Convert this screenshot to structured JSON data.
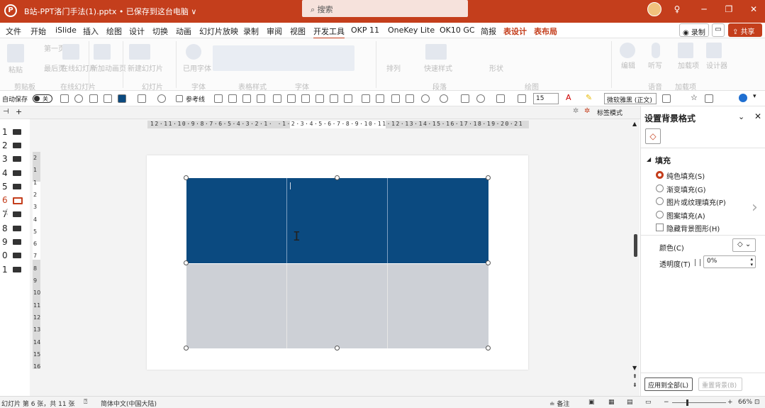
{
  "titlebar": {
    "title": "B站-PPT洛门手法(1).pptx • 已保存到这台电脑 ∨",
    "search_placeholder": "搜索",
    "accent": "#c43e1c"
  },
  "menu": {
    "tabs": [
      "文件",
      "开始",
      "iSlide",
      "插入",
      "绘图",
      "设计",
      "切换",
      "动画",
      "幻灯片放映",
      "录制",
      "审阅",
      "视图",
      "开发工具",
      "OKP 11",
      "OneKey Lite",
      "OK10 GC",
      "简报",
      "表设计",
      "表布局"
    ],
    "record_label": "录制",
    "share_label": "共享"
  },
  "ribbon": {
    "labels": [
      "粘贴",
      "剪贴板",
      "第一页",
      "最后页",
      "在线幻灯片",
      "在线幻灯片",
      "新加动画页",
      "新建幻灯片",
      "幻灯片",
      "已用字体",
      "字体",
      "表格样式",
      "字体",
      "排列",
      "快速样式",
      "形状",
      "段落",
      "绘图",
      "编辑",
      "听写",
      "语音",
      "加载项",
      "设计器",
      "加载项"
    ]
  },
  "qat": {
    "autosave_label": "自动保存",
    "autosave_state": "关",
    "ref_line_label": "参考线",
    "font_size": "15",
    "font_name": "微软雅黑 (正文)"
  },
  "thumbs": {
    "numbers": [
      "1",
      "2",
      "3",
      "4",
      "5",
      "6",
      "7",
      "8",
      "9",
      "0",
      "1"
    ],
    "selected_index": 5
  },
  "rulers": {
    "h_text": "12·11·10·9·8·7·6·5·4·3·2·1· ·1·2·3·4·5·6·7·8·9·10·11·12·13·14·15·16·17·18·19·20·21",
    "v_text": [
      "2",
      "1",
      "1",
      "2",
      "3",
      "4",
      "5",
      "6",
      "7",
      "8",
      "9",
      "10",
      "11",
      "12",
      "13",
      "14",
      "15",
      "16"
    ],
    "notes_label": "标签模式"
  },
  "table": {
    "header_color": "#0b4a80",
    "body_color": "#cdd0d6",
    "rows": 2,
    "cols": 3
  },
  "pane": {
    "title": "设置背景格式",
    "section": "填充",
    "options": [
      {
        "label": "纯色填充(S)",
        "selected": true
      },
      {
        "label": "渐变填充(G)",
        "selected": false
      },
      {
        "label": "图片或纹理填充(P)",
        "selected": false
      },
      {
        "label": "图案填充(A)",
        "selected": false
      }
    ],
    "hide_bg_label": "隐藏背景图形(H)",
    "color_label": "颜色(C)",
    "transparency_label": "透明度(T)",
    "transparency_value": "0%",
    "apply_all_label": "应用到全部(L)",
    "reset_label": "重置背景(B)"
  },
  "status": {
    "slide_info": "幻灯片 第 6 张，共 11 张",
    "language": "简体中文(中国大陆)",
    "notes": "备注",
    "zoom": "66%"
  }
}
